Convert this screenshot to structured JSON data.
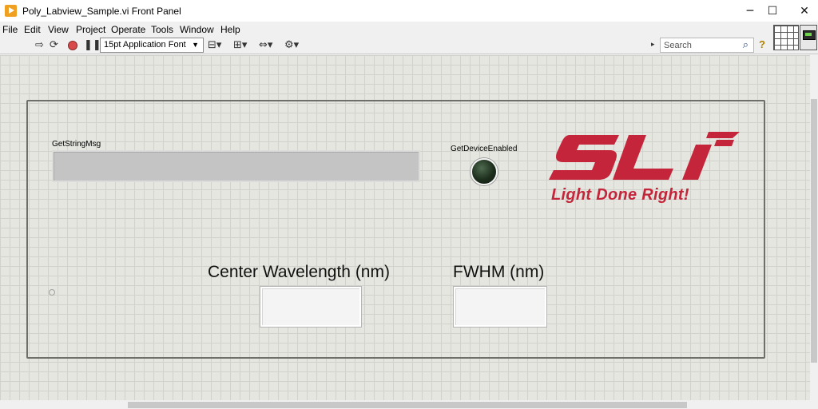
{
  "window": {
    "title": "Poly_Labview_Sample.vi Front Panel",
    "minimize_glyph": "─",
    "maximize_glyph": "☐",
    "close_glyph": "✕"
  },
  "menu": [
    "File",
    "Edit",
    "View",
    "Project",
    "Operate",
    "Tools",
    "Window",
    "Help"
  ],
  "toolbar": {
    "font_select_value": "15pt Application Font",
    "search_placeholder": "Search",
    "icons": [
      "run-arrow-icon",
      "run-continuously-icon",
      "abort-icon",
      "pause-icon",
      "align-objects-icon",
      "distribute-objects-icon",
      "resize-objects-icon",
      "reorder-icon",
      "search-icon",
      "help-icon"
    ]
  },
  "panel": {
    "string_indicator_label": "GetStringMsg",
    "led_label": "GetDeviceEnabled",
    "center_wavelength_label": "Center Wavelength (nm)",
    "fwhm_label": "FWHM (nm)",
    "center_wavelength_value": "",
    "fwhm_value": "",
    "led_state": "off"
  },
  "logo": {
    "text": "SLi",
    "tagline": "Light Done Right!",
    "color": "#c4253a"
  }
}
